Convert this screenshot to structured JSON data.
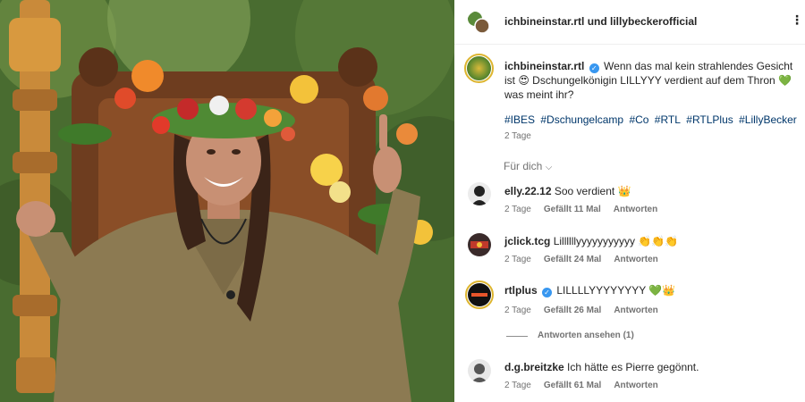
{
  "header": {
    "accounts": "ichbineinstar.rtl und lillybeckerofficial",
    "more": "⋮"
  },
  "post": {
    "username": "ichbineinstar.rtl",
    "caption": "Wenn das mal kein strahlendes Gesicht ist 😍 Dschungelkönigin LILLYYY verdient auf dem Thron 💚 was meint ihr?",
    "hashtags": [
      "#IBES",
      "#Dschungelcamp",
      "#Co",
      "#RTL",
      "#RTLPlus",
      "#LillyBecker"
    ],
    "time": "2 Tage",
    "translate": "Für dich"
  },
  "comments": [
    {
      "username": "elly.22.12",
      "text": "Soo verdient 👑",
      "time": "2 Tage",
      "likes": "Gefällt 11 Mal",
      "reply": "Antworten",
      "verified": false
    },
    {
      "username": "jclick.tcg",
      "text": "Lillllllyyyyyyyyyyy 👏👏👏",
      "time": "2 Tage",
      "likes": "Gefällt 24 Mal",
      "reply": "Antworten",
      "verified": false
    },
    {
      "username": "rtlplus",
      "text": "LILLLLYYYYYYYY 💚👑",
      "time": "2 Tage",
      "likes": "Gefällt 26 Mal",
      "reply": "Antworten",
      "verified": true
    },
    {
      "username": "d.g.breitzke",
      "text": "Ich hätte es Pierre gegönnt.",
      "time": "2 Tage",
      "likes": "Gefällt 61 Mal",
      "reply": "Antworten",
      "verified": false
    }
  ],
  "view_replies": "Antworten ansehen (1)"
}
